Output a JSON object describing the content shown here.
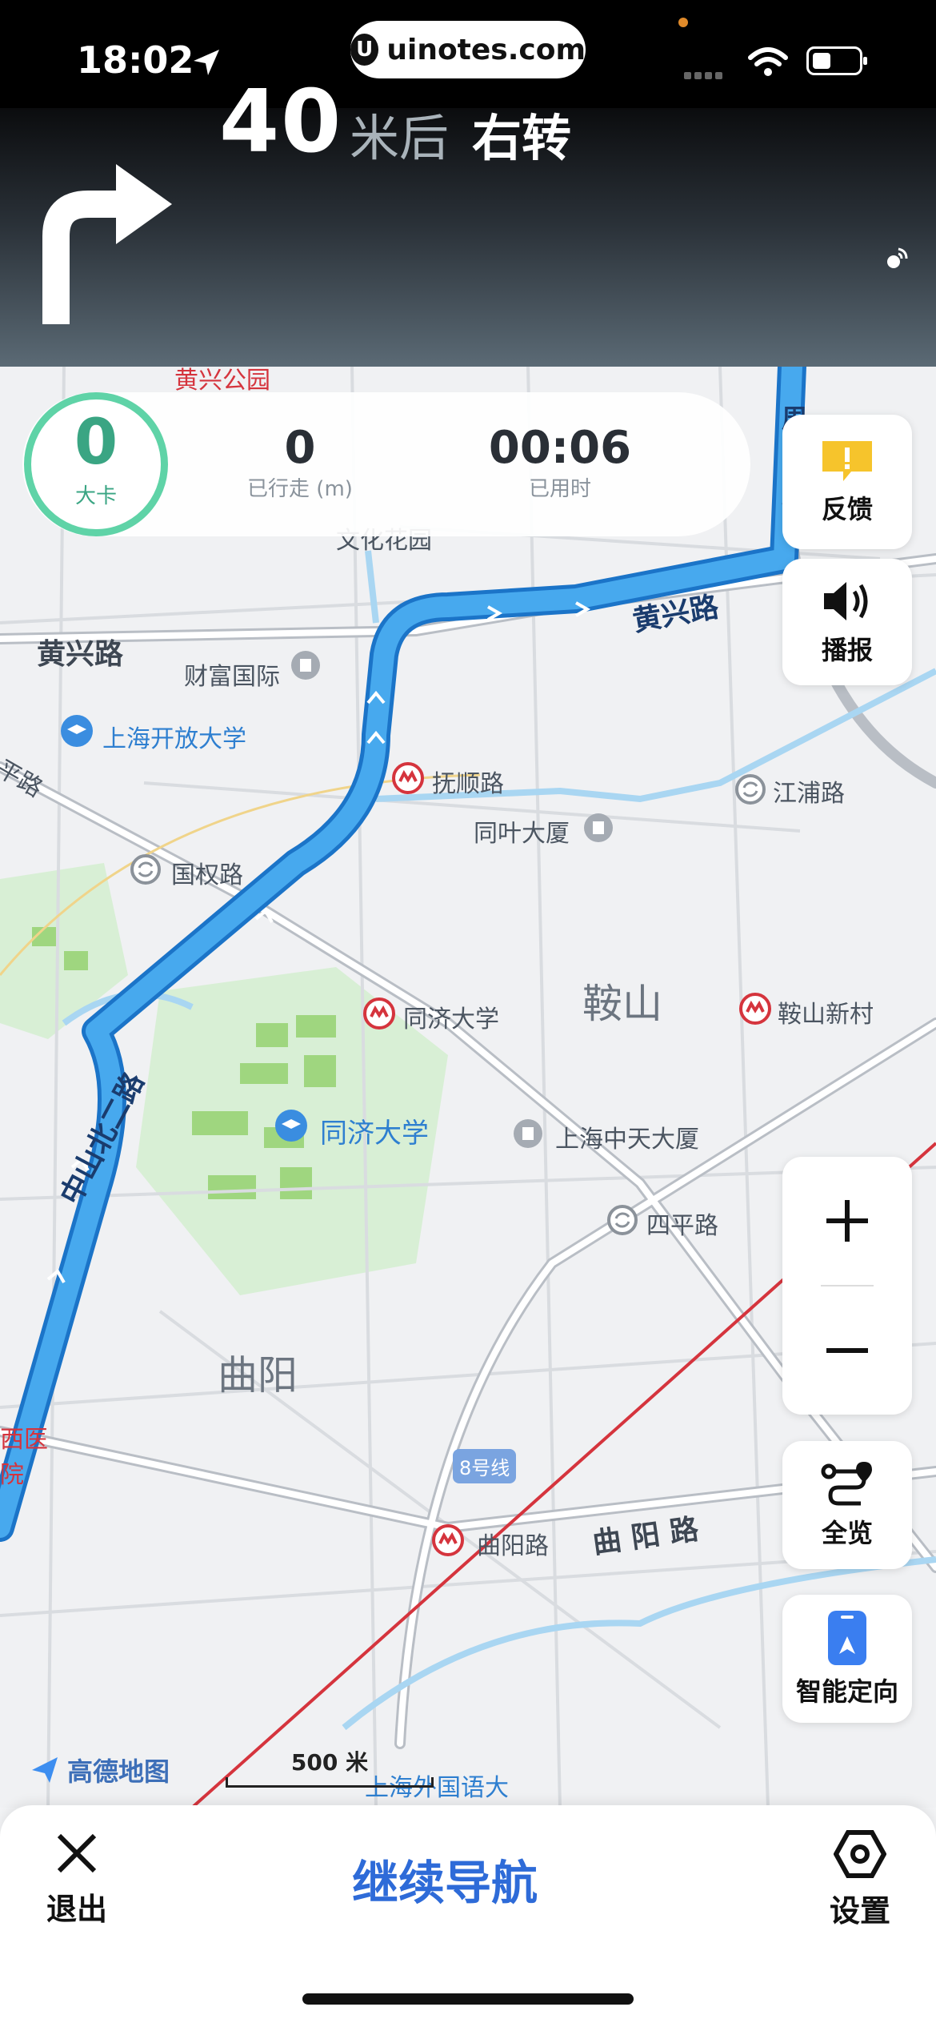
{
  "status_bar": {
    "time": "18:02",
    "url": "uinotes.com",
    "url_logo": "U"
  },
  "nav_header": {
    "distance": "40",
    "distance_unit": "米后",
    "action": "右转",
    "turn_icon": "turn-right-arrow-icon"
  },
  "stats": {
    "speed_value": "0",
    "speed_unit": "大卡",
    "walked_value": "0",
    "walked_label": "已行走 (m)",
    "time_value": "00:06",
    "time_label": "已用时"
  },
  "side_buttons": {
    "feedback_label": "反馈",
    "broadcast_label": "播报",
    "overview_label": "全览",
    "smart_locate_label": "智能定向"
  },
  "map_labels": {
    "huangxing_rd_left": "黄兴路",
    "huangxing_rd_route": "黄兴路",
    "caifu_intl": "财富国际",
    "open_university": "上海开放大学",
    "fushun_rd": "抚顺路",
    "jiangpu_rd": "江浦路",
    "tongye_building": "同叶大厦",
    "guoquan_rd": "国权路",
    "anshan": "鞍山",
    "anshan_xincun": "鞍山新村",
    "tongji_station": "同济大学",
    "tongji_univ": "同济大学",
    "zhongtian_building": "上海中天大厦",
    "siping_rd": "四平路",
    "quyang": "曲阳",
    "line8": "8号线",
    "quyang_rd_station": "曲阳路",
    "quyang_rd": "曲 阳 路",
    "zhongshan_rd": "中山北二路",
    "ping_rd": "平路",
    "hospital": "西医\n院",
    "wenhua_garden": "文化花园",
    "huangxing_park": "黄兴公园",
    "sisu": "上海外国语大",
    "zhoujiazui_rd": "周家嘴路"
  },
  "map_footer": {
    "brand": "高德地图",
    "scale": "500 米"
  },
  "bottom_bar": {
    "exit_label": "退出",
    "continue_label": "继续导航",
    "settings_label": "设置"
  },
  "colors": {
    "route": "#3a9bec",
    "accent_green": "#5fd3a7",
    "continue_blue": "#2e6bd8",
    "metro_red": "#d5343d"
  }
}
